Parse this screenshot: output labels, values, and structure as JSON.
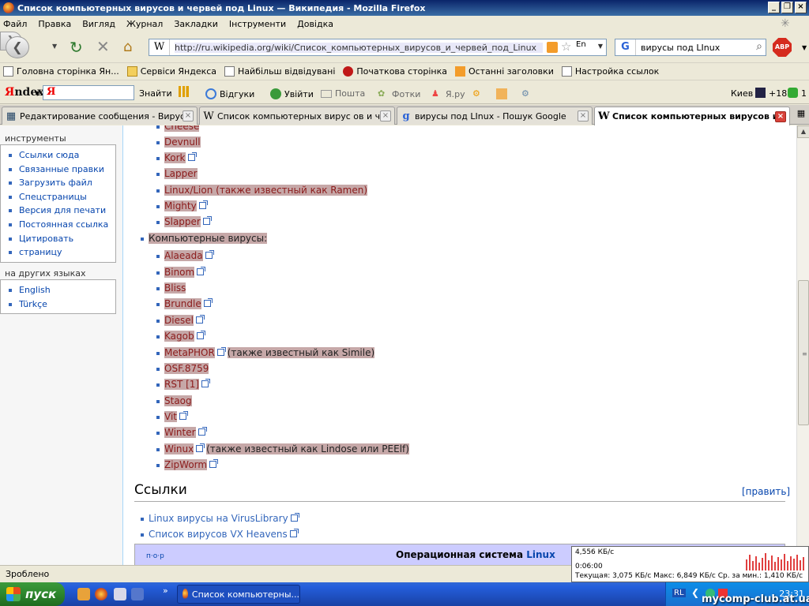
{
  "window": {
    "title": "Список компьютерных вирусов и червей под Linux — Википедия - Mozilla Firefox",
    "buttons": [
      "_",
      "❐",
      "×"
    ]
  },
  "menu": [
    "Файл",
    "Правка",
    "Вигляд",
    "Журнал",
    "Закладки",
    "Інструменти",
    "Довідка"
  ],
  "nav": {
    "url": "http://ru.wikipedia.org/wiki/Список_компьютерных_вирусов_и_червей_под_Linux",
    "lang_indicator": "En",
    "search_engine_icon": "G",
    "search_query": "вирусы под LInux",
    "abp_label": "ABP"
  },
  "bookmarks": [
    {
      "label": "Головна сторінка Ян...",
      "icon": "page-icon"
    },
    {
      "label": "Сервіси Яндекса",
      "icon": "folder-icon"
    },
    {
      "label": "Найбільш відвідувані",
      "icon": "page-icon"
    },
    {
      "label": "Початкова сторінка",
      "icon": "red-icon"
    },
    {
      "label": "Останні заголовки",
      "icon": "rss-icon"
    },
    {
      "label": "Настройка ссылок",
      "icon": "page-icon"
    }
  ],
  "yandex_bar": {
    "logo_prefix": "Я",
    "logo_suffix": "ndex",
    "input_logo": "Я",
    "find_label": "Знайти",
    "feedback": "Відгуки",
    "login": "Увійти",
    "mail": "Пошта",
    "photos": "Фотки",
    "yaru": "Я.ру",
    "city": "Киев",
    "temperature": "+18",
    "counter": "1"
  },
  "tabs": [
    {
      "label": "Редактирование сообщения - Вирус...",
      "icon": "forum-icon",
      "active": false
    },
    {
      "label": "Список компьютерных вирус ов и ч...",
      "icon": "W",
      "active": false
    },
    {
      "label": "вирусы под LInux - Пошук Google",
      "icon": "g",
      "active": false
    },
    {
      "label": "Список компьютерных вирусов и ...",
      "icon": "W",
      "active": true
    }
  ],
  "sidebar": {
    "tools_header": "инструменты",
    "tools": [
      "Ссылки сюда",
      "Связанные правки",
      "Загрузить файл",
      "Спецстраницы",
      "Версия для печати",
      "Постоянная ссылка",
      "Цитировать",
      "страницу"
    ],
    "languages_header": "на других языках",
    "languages": [
      "English",
      "Türkçe"
    ]
  },
  "article": {
    "worms_partial": "Cheese",
    "worms": [
      {
        "name": "Devnull",
        "ext": false,
        "note": ""
      },
      {
        "name": "Kork",
        "ext": true,
        "note": ""
      },
      {
        "name": "Lapper",
        "ext": false,
        "note": ""
      },
      {
        "name": "Linux/Lion (также известный как Ramen)",
        "ext": false,
        "note": ""
      },
      {
        "name": "Mighty",
        "ext": true,
        "note": ""
      },
      {
        "name": "Slapper",
        "ext": true,
        "note": ""
      }
    ],
    "viruses_header": "Компьютерные вирусы:",
    "viruses": [
      {
        "name": "Alaeada",
        "ext": true,
        "note": ""
      },
      {
        "name": "Binom",
        "ext": true,
        "note": ""
      },
      {
        "name": "Bliss",
        "ext": false,
        "note": ""
      },
      {
        "name": "Brundle",
        "ext": true,
        "note": ""
      },
      {
        "name": "Diesel",
        "ext": true,
        "note": ""
      },
      {
        "name": "Kagob",
        "ext": true,
        "note": ""
      },
      {
        "name": "MetaPHOR",
        "ext": true,
        "note": "(также известный как Simile)"
      },
      {
        "name": "OSF.8759",
        "ext": false,
        "note": ""
      },
      {
        "name": "RST [1]",
        "ext": true,
        "note": ""
      },
      {
        "name": "Staog",
        "ext": false,
        "note": ""
      },
      {
        "name": "Vit",
        "ext": true,
        "note": ""
      },
      {
        "name": "Winter",
        "ext": true,
        "note": ""
      },
      {
        "name": "Winux",
        "ext": true,
        "note": "(также известный как Lindose или PEElf)"
      },
      {
        "name": "ZipWorm",
        "ext": true,
        "note": ""
      }
    ],
    "links_header": "Ссылки",
    "edit_label": "[править]",
    "external_links": [
      "Linux вирусы на VirusLibrary",
      "Список вирусов VX Heavens"
    ],
    "navbox_vde": "п·о·р",
    "navbox_title_prefix": "Операционная система ",
    "navbox_title_link": "Linux"
  },
  "status": {
    "text": "Зроблено"
  },
  "meter": {
    "speed": "4,556 КБ/с",
    "time": "0:06:00",
    "summary": "Текущая: 3,075 КБ/с   Макс: 6,849 КБ/с   Ср. за мин.: 1,410 КБ/с"
  },
  "taskbar": {
    "start": "пуск",
    "task": "Список компьютерны...",
    "lang": "RL",
    "clock": "23:31",
    "watermark": "mycomp-club.at.ua"
  },
  "colors": {
    "highlight": "#c6a8a8",
    "link": "#0645ad",
    "titlebar": "#0A246A"
  }
}
